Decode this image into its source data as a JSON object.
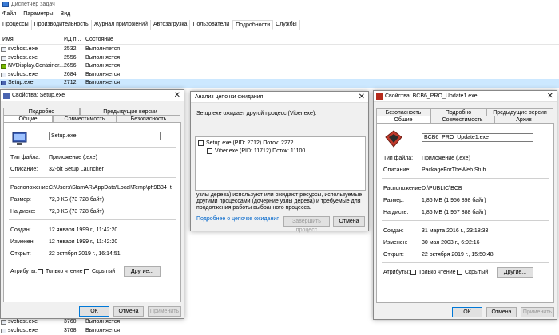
{
  "task_manager": {
    "title": "Диспетчер задач",
    "menu": [
      "Файл",
      "Параметры",
      "Вид"
    ],
    "tabs": [
      "Процессы",
      "Производительность",
      "Журнал приложений",
      "Автозагрузка",
      "Пользователи",
      "Подробности",
      "Службы"
    ],
    "active_tab": "Подробности",
    "columns": {
      "name": "Имя",
      "pid": "ИД п...",
      "state": "Состояние"
    },
    "rows": [
      {
        "name": "svchost.exe",
        "pid": "2532",
        "state": "Выполняется"
      },
      {
        "name": "svchost.exe",
        "pid": "2556",
        "state": "Выполняется"
      },
      {
        "name": "NVDisplay.Container...",
        "pid": "2656",
        "state": "Выполняется"
      },
      {
        "name": "svchost.exe",
        "pid": "2684",
        "state": "Выполняется"
      },
      {
        "name": "Setup.exe",
        "pid": "2712",
        "state": "Выполняется"
      }
    ],
    "bottom_rows": [
      {
        "name": "svchost.exe",
        "pid": "3760",
        "state": "Выполняется"
      },
      {
        "name": "svchost.exe",
        "pid": "3768",
        "state": "Выполняется"
      }
    ]
  },
  "setup_props": {
    "title": "Свойства: Setup.exe",
    "tabs_top": [
      "Подробно",
      "Предыдущие версии"
    ],
    "tabs_bottom": [
      "Общие",
      "Совместимость",
      "Безопасность"
    ],
    "file_name": "Setup.exe",
    "type_label": "Тип файла:",
    "type_value": "Приложение (.exe)",
    "desc_label": "Описание:",
    "desc_value": "32-bit Setup Launcher",
    "loc_label": "Расположение:",
    "loc_value": "C:\\Users\\SlamAR\\AppData\\Local\\Temp\\pft9B34~t",
    "size_label": "Размер:",
    "size_value": "72,0 КБ (73 728 байт)",
    "disk_label": "На диске:",
    "disk_value": "72,0 КБ (73 728 байт)",
    "created_label": "Создан:",
    "created_value": "12 января 1999 г., 11:42:20",
    "modified_label": "Изменен:",
    "modified_value": "12 января 1999 г., 11:42:20",
    "opened_label": "Открыт:",
    "opened_value": "22 октября 2019 г., 16:14:51",
    "attr_label": "Атрибуты:",
    "readonly": "Только чтение",
    "hidden": "Скрытый",
    "other_btn": "Другие...",
    "ok": "ОК",
    "cancel": "Отмена",
    "apply": "Применить"
  },
  "wait_chain": {
    "title": "Анализ цепочки ожидания",
    "message": "Setup.exe ожидает другой процесс (Viber.exe).",
    "item1": "Setup.exe (PID: 2712) Поток: 2272",
    "item2": "Viber.exe (PID: 11712) Поток: 11100",
    "note": "узлы дерева) используют или ожидают ресурсы, используемые другими процессами (дочерние узлы дерева) и требуемые для продолжения работы выбранного процесса.",
    "link": "Подробнее о цепочке ожидания",
    "end_btn": "Завершить процесс",
    "cancel_btn": "Отмена"
  },
  "bcb_props": {
    "title": "Свойства: BCB6_PRO_Update1.exe",
    "tabs_top": [
      "Безопасность",
      "Подробно",
      "Предыдущие версии"
    ],
    "tabs_bottom": [
      "Общие",
      "Совместимость",
      "Архив"
    ],
    "file_name": "BCB6_PRO_Update1.exe",
    "type_label": "Тип файла:",
    "type_value": "Приложение (.exe)",
    "desc_label": "Описание:",
    "desc_value": "PackageForTheWeb Stub",
    "loc_label": "Расположение:",
    "loc_value": "D:\\PUBLIC\\BCB",
    "size_label": "Размер:",
    "size_value": "1,86 МБ (1 956 898 байт)",
    "disk_label": "На диске:",
    "disk_value": "1,86 МБ (1 957 888 байт)",
    "created_label": "Создан:",
    "created_value": "31 марта 2016 г., 23:18:33",
    "modified_label": "Изменен:",
    "modified_value": "30 мая 2003 г., 6:02:16",
    "opened_label": "Открыт:",
    "opened_value": "22 октября 2019 г., 15:50:48",
    "attr_label": "Атрибуты:",
    "readonly": "Только чтение",
    "hidden": "Скрытый",
    "other_btn": "Другие...",
    "ok": "ОК",
    "cancel": "Отмена",
    "apply": "Применить"
  }
}
